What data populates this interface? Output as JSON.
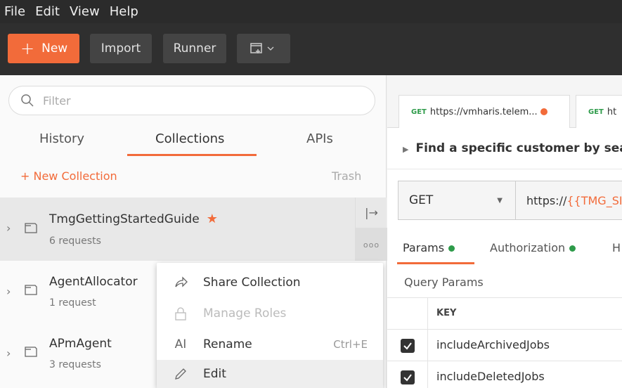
{
  "menubar": {
    "items": [
      "File",
      "Edit",
      "View",
      "Help"
    ]
  },
  "toolbar": {
    "new_label": "New",
    "import_label": "Import",
    "runner_label": "Runner"
  },
  "sidebar": {
    "filter_placeholder": "Filter",
    "tabs": [
      "History",
      "Collections",
      "APIs"
    ],
    "active_tab": "Collections",
    "new_collection_label": "+ New Collection",
    "trash_label": "Trash",
    "collections": [
      {
        "name": "TmgGettingStartedGuide",
        "count": "6 requests",
        "starred": true
      },
      {
        "name": "AgentAllocator",
        "count": "1 request",
        "starred": false
      },
      {
        "name": "APmAgent",
        "count": "3 requests",
        "starred": false
      }
    ]
  },
  "context_menu": {
    "items": [
      {
        "icon": "share-icon",
        "label": "Share Collection",
        "shortcut": "",
        "disabled": false
      },
      {
        "icon": "lock-icon",
        "label": "Manage Roles",
        "shortcut": "",
        "disabled": true
      },
      {
        "icon": "rename-icon",
        "label": "Rename",
        "shortcut": "Ctrl+E",
        "disabled": false
      },
      {
        "icon": "pencil-icon",
        "label": "Edit",
        "shortcut": "",
        "disabled": false
      }
    ]
  },
  "main": {
    "tabs": [
      {
        "method": "GET",
        "label": "https://vmharis.telem...",
        "unsaved": true
      },
      {
        "method": "GET",
        "label": "ht",
        "unsaved": false
      }
    ],
    "request_name": "Find a specific customer by sear",
    "method": "GET",
    "url_prefix": "https://",
    "url_var": "{{TMG_SIT",
    "param_tabs": [
      "Params",
      "Authorization",
      "H"
    ],
    "query_params_label": "Query Params",
    "key_header": "KEY",
    "params": [
      {
        "key": "includeArchivedJobs",
        "checked": true
      },
      {
        "key": "includeDeletedJobs",
        "checked": true
      }
    ]
  },
  "colors": {
    "accent": "#f26b3a",
    "success": "#2e9b4a",
    "toolbar_bg": "#2f2f2f"
  }
}
